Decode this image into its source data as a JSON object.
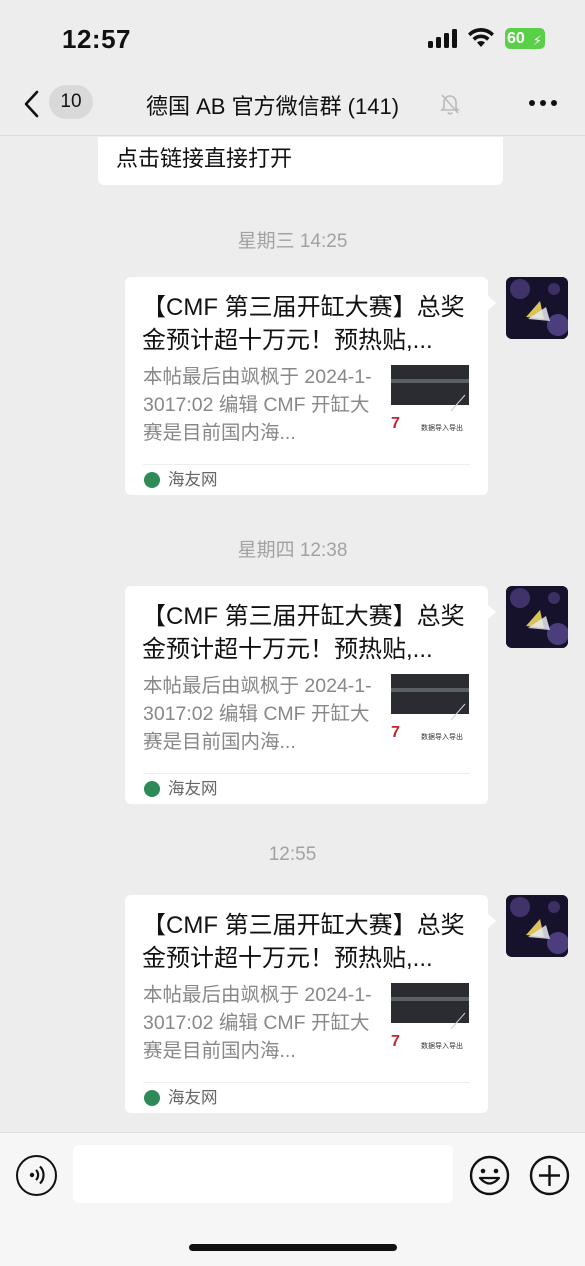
{
  "status_bar": {
    "time": "12:57",
    "battery": "60"
  },
  "nav": {
    "unread_count": "10",
    "title": "德国 AB  官方微信群 (141)"
  },
  "chat": {
    "previous_message": "点击链接直接打开",
    "messages": [
      {
        "timestamp": "星期三 14:25",
        "title": "【CMF 第三届开缸大赛】总奖金预计超十万元！预热贴,...",
        "description": "本帖最后由飒枫于 2024-1-3017:02 编辑 CMF 开缸大赛是目前国内海...",
        "source": "海友网",
        "thumb_text": "数据导入导出",
        "thumb_number": "7"
      },
      {
        "timestamp": "星期四 12:38",
        "title": "【CMF 第三届开缸大赛】总奖金预计超十万元！预热贴,...",
        "description": "本帖最后由飒枫于 2024-1-3017:02 编辑 CMF 开缸大赛是目前国内海...",
        "source": "海友网",
        "thumb_text": "数据导入导出",
        "thumb_number": "7"
      },
      {
        "timestamp": "12:55",
        "title": "【CMF 第三届开缸大赛】总奖金预计超十万元！预热贴,...",
        "description": "本帖最后由飒枫于 2024-1-3017:02 编辑 CMF 开缸大赛是目前国内海...",
        "source": "海友网",
        "thumb_text": "数据导入导出",
        "thumb_number": "7"
      }
    ]
  },
  "input_bar": {
    "placeholder": ""
  },
  "colors": {
    "background": "#ededed",
    "bubble": "#ffffff",
    "timestamp": "#a2a2a2",
    "battery": "#5ad049"
  },
  "icons": [
    "back-icon",
    "mute-icon",
    "more-icon",
    "voice-icon",
    "emoji-icon",
    "plus-icon",
    "signal-icon",
    "wifi-icon"
  ]
}
